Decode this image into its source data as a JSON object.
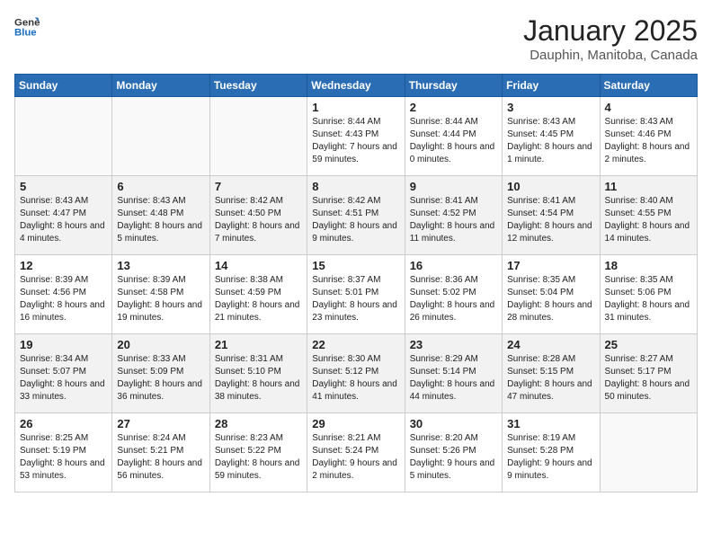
{
  "logo": {
    "line1": "General",
    "line2": "Blue"
  },
  "title": "January 2025",
  "subtitle": "Dauphin, Manitoba, Canada",
  "days_of_week": [
    "Sunday",
    "Monday",
    "Tuesday",
    "Wednesday",
    "Thursday",
    "Friday",
    "Saturday"
  ],
  "weeks": [
    [
      {
        "day": "",
        "info": ""
      },
      {
        "day": "",
        "info": ""
      },
      {
        "day": "",
        "info": ""
      },
      {
        "day": "1",
        "info": "Sunrise: 8:44 AM\nSunset: 4:43 PM\nDaylight: 7 hours and 59 minutes."
      },
      {
        "day": "2",
        "info": "Sunrise: 8:44 AM\nSunset: 4:44 PM\nDaylight: 8 hours and 0 minutes."
      },
      {
        "day": "3",
        "info": "Sunrise: 8:43 AM\nSunset: 4:45 PM\nDaylight: 8 hours and 1 minute."
      },
      {
        "day": "4",
        "info": "Sunrise: 8:43 AM\nSunset: 4:46 PM\nDaylight: 8 hours and 2 minutes."
      }
    ],
    [
      {
        "day": "5",
        "info": "Sunrise: 8:43 AM\nSunset: 4:47 PM\nDaylight: 8 hours and 4 minutes."
      },
      {
        "day": "6",
        "info": "Sunrise: 8:43 AM\nSunset: 4:48 PM\nDaylight: 8 hours and 5 minutes."
      },
      {
        "day": "7",
        "info": "Sunrise: 8:42 AM\nSunset: 4:50 PM\nDaylight: 8 hours and 7 minutes."
      },
      {
        "day": "8",
        "info": "Sunrise: 8:42 AM\nSunset: 4:51 PM\nDaylight: 8 hours and 9 minutes."
      },
      {
        "day": "9",
        "info": "Sunrise: 8:41 AM\nSunset: 4:52 PM\nDaylight: 8 hours and 11 minutes."
      },
      {
        "day": "10",
        "info": "Sunrise: 8:41 AM\nSunset: 4:54 PM\nDaylight: 8 hours and 12 minutes."
      },
      {
        "day": "11",
        "info": "Sunrise: 8:40 AM\nSunset: 4:55 PM\nDaylight: 8 hours and 14 minutes."
      }
    ],
    [
      {
        "day": "12",
        "info": "Sunrise: 8:39 AM\nSunset: 4:56 PM\nDaylight: 8 hours and 16 minutes."
      },
      {
        "day": "13",
        "info": "Sunrise: 8:39 AM\nSunset: 4:58 PM\nDaylight: 8 hours and 19 minutes."
      },
      {
        "day": "14",
        "info": "Sunrise: 8:38 AM\nSunset: 4:59 PM\nDaylight: 8 hours and 21 minutes."
      },
      {
        "day": "15",
        "info": "Sunrise: 8:37 AM\nSunset: 5:01 PM\nDaylight: 8 hours and 23 minutes."
      },
      {
        "day": "16",
        "info": "Sunrise: 8:36 AM\nSunset: 5:02 PM\nDaylight: 8 hours and 26 minutes."
      },
      {
        "day": "17",
        "info": "Sunrise: 8:35 AM\nSunset: 5:04 PM\nDaylight: 8 hours and 28 minutes."
      },
      {
        "day": "18",
        "info": "Sunrise: 8:35 AM\nSunset: 5:06 PM\nDaylight: 8 hours and 31 minutes."
      }
    ],
    [
      {
        "day": "19",
        "info": "Sunrise: 8:34 AM\nSunset: 5:07 PM\nDaylight: 8 hours and 33 minutes."
      },
      {
        "day": "20",
        "info": "Sunrise: 8:33 AM\nSunset: 5:09 PM\nDaylight: 8 hours and 36 minutes."
      },
      {
        "day": "21",
        "info": "Sunrise: 8:31 AM\nSunset: 5:10 PM\nDaylight: 8 hours and 38 minutes."
      },
      {
        "day": "22",
        "info": "Sunrise: 8:30 AM\nSunset: 5:12 PM\nDaylight: 8 hours and 41 minutes."
      },
      {
        "day": "23",
        "info": "Sunrise: 8:29 AM\nSunset: 5:14 PM\nDaylight: 8 hours and 44 minutes."
      },
      {
        "day": "24",
        "info": "Sunrise: 8:28 AM\nSunset: 5:15 PM\nDaylight: 8 hours and 47 minutes."
      },
      {
        "day": "25",
        "info": "Sunrise: 8:27 AM\nSunset: 5:17 PM\nDaylight: 8 hours and 50 minutes."
      }
    ],
    [
      {
        "day": "26",
        "info": "Sunrise: 8:25 AM\nSunset: 5:19 PM\nDaylight: 8 hours and 53 minutes."
      },
      {
        "day": "27",
        "info": "Sunrise: 8:24 AM\nSunset: 5:21 PM\nDaylight: 8 hours and 56 minutes."
      },
      {
        "day": "28",
        "info": "Sunrise: 8:23 AM\nSunset: 5:22 PM\nDaylight: 8 hours and 59 minutes."
      },
      {
        "day": "29",
        "info": "Sunrise: 8:21 AM\nSunset: 5:24 PM\nDaylight: 9 hours and 2 minutes."
      },
      {
        "day": "30",
        "info": "Sunrise: 8:20 AM\nSunset: 5:26 PM\nDaylight: 9 hours and 5 minutes."
      },
      {
        "day": "31",
        "info": "Sunrise: 8:19 AM\nSunset: 5:28 PM\nDaylight: 9 hours and 9 minutes."
      },
      {
        "day": "",
        "info": ""
      }
    ]
  ]
}
